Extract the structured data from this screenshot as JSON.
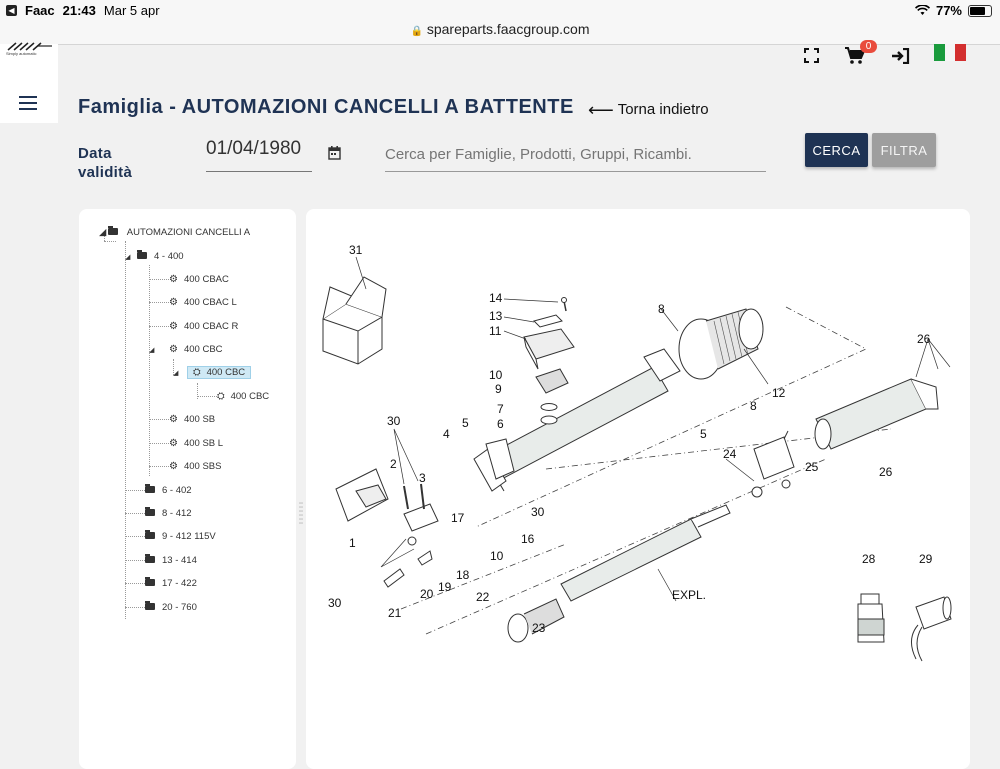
{
  "status": {
    "app": "Faac",
    "time": "21:43",
    "date": "Mar 5 apr",
    "battery": "77%"
  },
  "browser": {
    "url": "spareparts.faacgroup.com"
  },
  "header": {
    "logo_sub": "Simply automatic",
    "cart_count": "0"
  },
  "page": {
    "title": "Famiglia - AUTOMAZIONI CANCELLI A BATTENTE",
    "back_label": "Torna indietro"
  },
  "filter": {
    "date_label_1": "Data",
    "date_label_2": "validità",
    "date_value": "01/04/1980",
    "search_placeholder": "Cerca per Famiglie, Prodotti, Gruppi, Ricambi.",
    "search_button": "CERCA",
    "filter_button": "FILTRA"
  },
  "tree": {
    "root": "AUTOMAZIONI CANCELLI A",
    "items": [
      {
        "label": "4 - 400"
      },
      {
        "label": "400 CBAC"
      },
      {
        "label": "400 CBAC L"
      },
      {
        "label": "400 CBAC R"
      },
      {
        "label": "400 CBC"
      },
      {
        "label": "400 CBC"
      },
      {
        "label": "400 CBC"
      },
      {
        "label": "400 SB"
      },
      {
        "label": "400 SB L"
      },
      {
        "label": "400 SBS"
      },
      {
        "label": "6 - 402"
      },
      {
        "label": "8 - 412"
      },
      {
        "label": "9 - 412 115V"
      },
      {
        "label": "13 - 414"
      },
      {
        "label": "17 - 422"
      },
      {
        "label": "20 - 760"
      }
    ]
  },
  "diagram": {
    "labels": [
      "31",
      "14",
      "13",
      "11",
      "8",
      "10",
      "9",
      "7",
      "6",
      "12",
      "8",
      "26",
      "30",
      "2",
      "4",
      "5",
      "5",
      "3",
      "1",
      "24",
      "25",
      "26",
      "17",
      "16",
      "30",
      "10",
      "18",
      "19",
      "30",
      "21",
      "20",
      "22",
      "23",
      "EXPL.",
      "28",
      "29"
    ]
  },
  "colors": {
    "navy": "#1f3354",
    "gray_button": "#9e9e9e",
    "selected": "#cfe9f5",
    "badge": "#e94b3c",
    "flag_green": "#1a9b3d",
    "flag_red": "#d32f2f"
  }
}
